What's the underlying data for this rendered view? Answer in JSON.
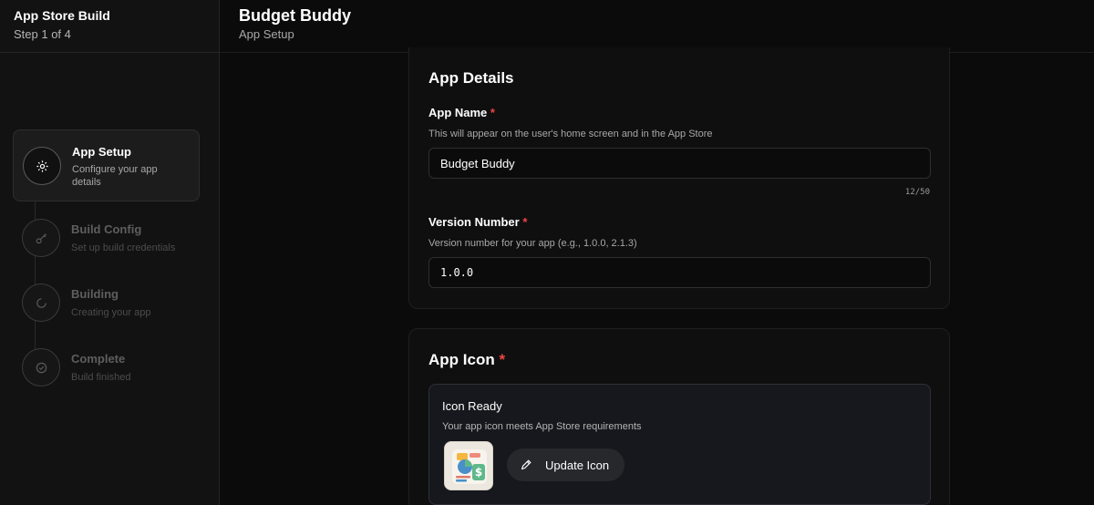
{
  "sidebar": {
    "title": "App Store Build",
    "step_counter": "Step 1 of 4",
    "steps": [
      {
        "name": "App Setup",
        "desc": "Configure your app details",
        "icon": "gear-icon",
        "state": "active"
      },
      {
        "name": "Build Config",
        "desc": "Set up build credentials",
        "icon": "key-icon",
        "state": "inactive"
      },
      {
        "name": "Building",
        "desc": "Creating your app",
        "icon": "spinner-icon",
        "state": "inactive"
      },
      {
        "name": "Complete",
        "desc": "Build finished",
        "icon": "check-circle-icon",
        "state": "inactive"
      }
    ]
  },
  "header": {
    "title": "Budget Buddy",
    "subtitle": "App Setup"
  },
  "app_details": {
    "heading": "App Details",
    "app_name": {
      "label": "App Name",
      "required_mark": "*",
      "help": "This will appear on the user's home screen and in the App Store",
      "value": "Budget Buddy",
      "counter": "12/50"
    },
    "version": {
      "label": "Version Number",
      "required_mark": "*",
      "help": "Version number for your app (e.g., 1.0.0, 2.1.3)",
      "value": "1.0.0"
    }
  },
  "app_icon": {
    "heading": "App Icon",
    "required_mark": "*",
    "status_title": "Icon Ready",
    "status_desc": "Your app icon meets App Store requirements",
    "update_label": "Update Icon"
  },
  "colors": {
    "background": "#0b0b0b",
    "accent_required": "#ef4444",
    "panel": "#16181d"
  }
}
